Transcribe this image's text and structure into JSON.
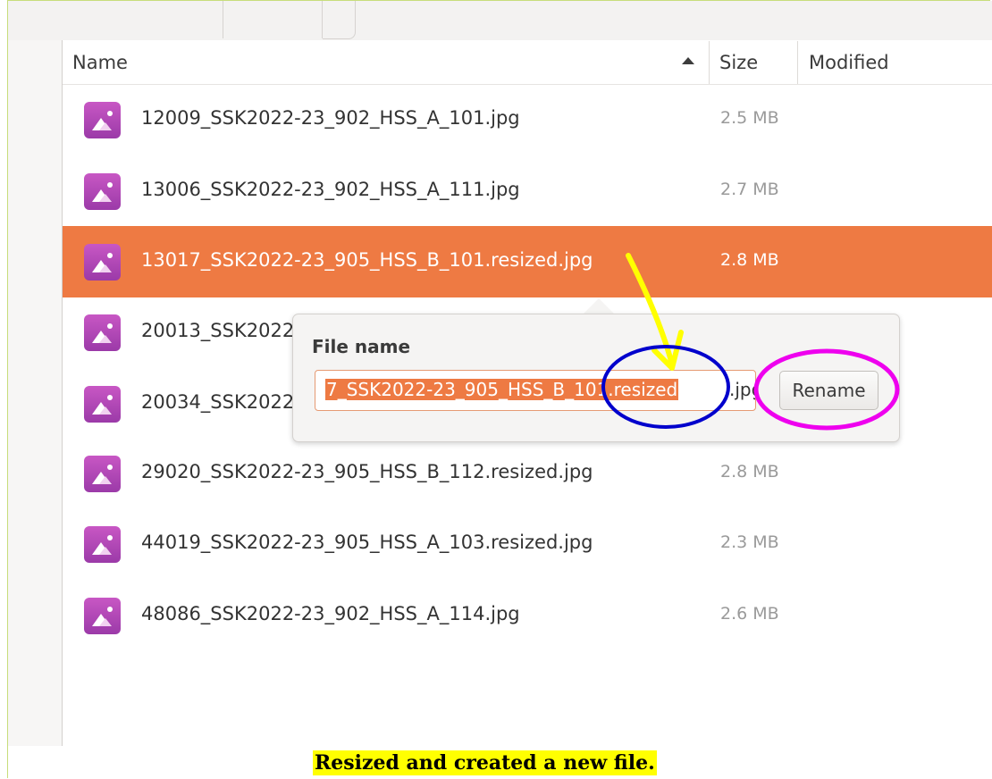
{
  "header": {
    "name_label": "Name",
    "size_label": "Size",
    "modified_label": "Modified"
  },
  "files": [
    {
      "name": "12009_SSK2022-23_902_HSS_A_101.jpg",
      "size": "2.5 MB",
      "selected": false
    },
    {
      "name": "13006_SSK2022-23_902_HSS_A_111.jpg",
      "size": "2.7 MB",
      "selected": false
    },
    {
      "name": "13017_SSK2022-23_905_HSS_B_101.resized.jpg",
      "size": "2.8 MB",
      "selected": true
    },
    {
      "name": "20013_SSK2022",
      "size": "",
      "selected": false
    },
    {
      "name": "20034_SSK2022",
      "size": "",
      "selected": false
    },
    {
      "name": "29020_SSK2022-23_905_HSS_B_112.resized.jpg",
      "size": "2.8 MB",
      "selected": false
    },
    {
      "name": "44019_SSK2022-23_905_HSS_A_103.resized.jpg",
      "size": "2.3 MB",
      "selected": false
    },
    {
      "name": "48086_SSK2022-23_902_HSS_A_114.jpg",
      "size": "2.6 MB",
      "selected": false
    }
  ],
  "rename_popover": {
    "label": "File name",
    "input_selected_text": "7_SSK2022-23_905_HSS_B_101.resized",
    "input_rest_text": ".jpg",
    "button_label": "Rename"
  },
  "caption": "Resized and created a new file.",
  "icons": {
    "file": "image-file-icon",
    "sort": "sort-ascending-icon"
  },
  "colors": {
    "selection": "#ee7a43",
    "arrow_annotation": "#ffff00",
    "circle_blue": "#0000cc",
    "circle_magenta": "#ee00ee"
  }
}
